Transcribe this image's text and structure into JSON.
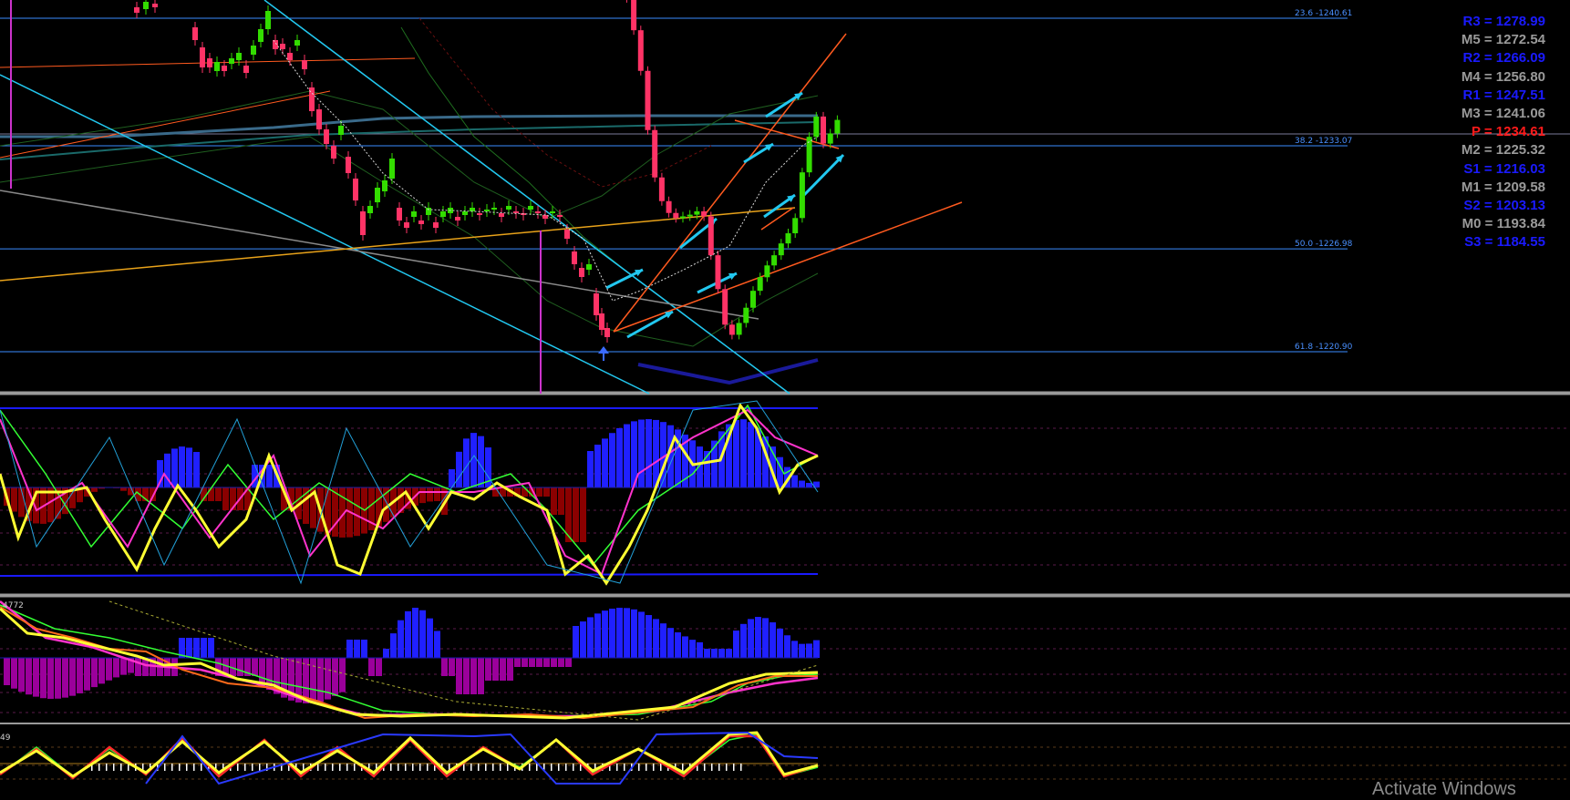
{
  "chart_data": {
    "type": "candlestick",
    "colors": {
      "background": "#000000",
      "bull": "#33dd00",
      "bear": "#ff3366",
      "fib_level": "#3a8cff",
      "fib_text": "#4a90ff",
      "pivot_resistance": "#1a1aff",
      "pivot_mid": "#9a9a9a",
      "pivot_p": "#ff1a1a",
      "channel": "#ff5a1f",
      "trend_cyan": "#22c8f0",
      "hist_pos": "#2020ff",
      "hist_neg": "#8b0000",
      "hist_neg2": "#9b009b",
      "osc_yellow": "#ffff33"
    },
    "price_levels": [
      {
        "label": "23.6 -1240.61",
        "price": 1240.61
      },
      {
        "label": "38.2 -1233.07",
        "price": 1233.07
      },
      {
        "label": "50.0 -1226.98",
        "price": 1226.98
      },
      {
        "label": "61.8 -1220.90",
        "price": 1220.9
      }
    ],
    "pivots": [
      {
        "label": "R3 = 1278.99",
        "kind": "resistance"
      },
      {
        "label": "M5 = 1272.54",
        "kind": "mid"
      },
      {
        "label": "R2 = 1266.09",
        "kind": "resistance"
      },
      {
        "label": "M4 = 1256.80",
        "kind": "mid"
      },
      {
        "label": "R1 = 1247.51",
        "kind": "resistance"
      },
      {
        "label": "M3 = 1241.06",
        "kind": "mid"
      },
      {
        "label": "P  = 1234.61",
        "kind": "pivot"
      },
      {
        "label": "M2 = 1225.32",
        "kind": "mid"
      },
      {
        "label": "S1 = 1216.03",
        "kind": "resistance"
      },
      {
        "label": "M1 = 1209.58",
        "kind": "mid"
      },
      {
        "label": "S2 = 1203.13",
        "kind": "resistance"
      },
      {
        "label": "M0 = 1193.84",
        "kind": "mid"
      },
      {
        "label": "S3 = 1184.55",
        "kind": "resistance"
      }
    ],
    "indicator_labels": {
      "sub2": "4772",
      "sub3": "49"
    },
    "series": [
      {
        "name": "close",
        "values": [
          1243.5,
          1243.0,
          1241.8,
          1239.9,
          1237.5,
          1234.0,
          1231.2,
          1229.8,
          1229.1,
          1228.8,
          1228.9,
          1229.0,
          1229.2,
          1228.9,
          1226.6,
          1224.6,
          1222.5,
          1221.9,
          1222.6,
          1223.5,
          1224.5,
          1225.3,
          1226.0,
          1226.6,
          1227.3,
          1227.9,
          1228.8,
          1231.5,
          1233.6,
          1234.8,
          1233.2,
          1233.8,
          1234.6
        ]
      }
    ]
  },
  "watermark": "Activate Windows"
}
